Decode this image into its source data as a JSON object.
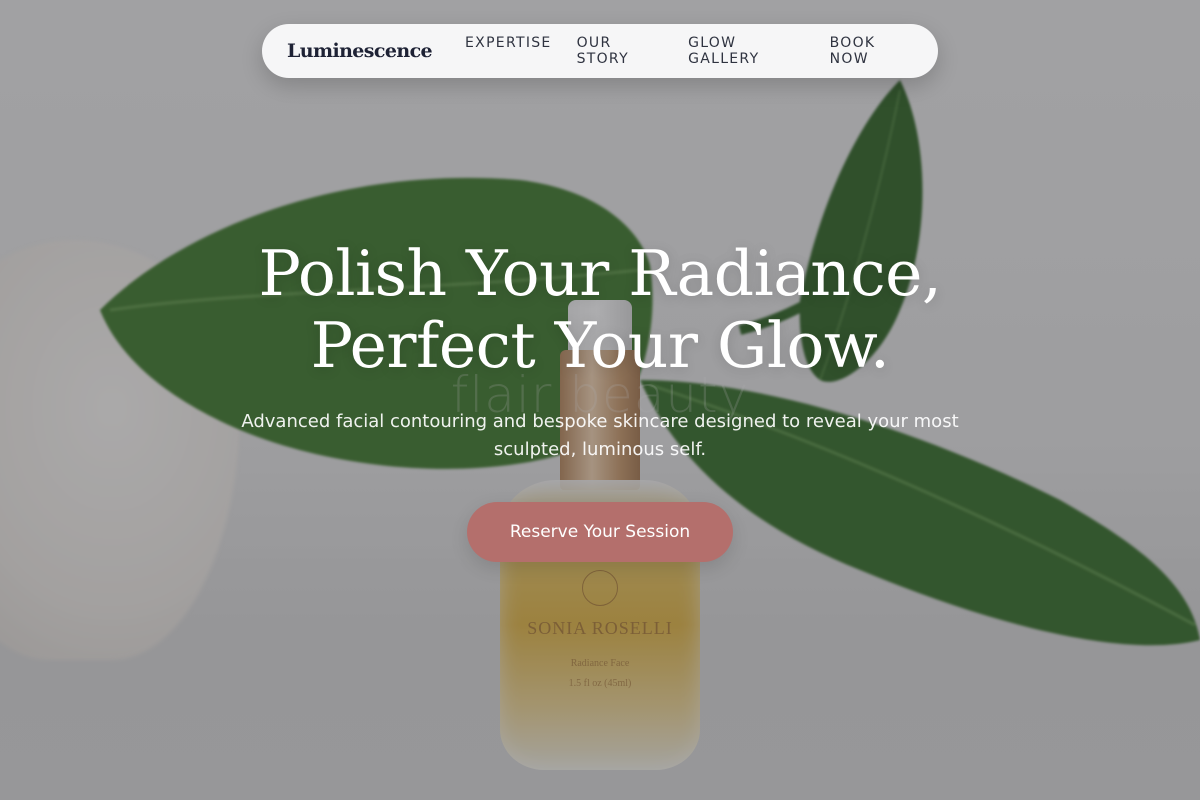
{
  "nav": {
    "logo": "Luminescence",
    "links": [
      "EXPERTISE",
      "OUR STORY",
      "GLOW GALLERY",
      "BOOK NOW"
    ]
  },
  "hero": {
    "headline_line1": "Polish Your Radiance,",
    "headline_line2": "Perfect Your Glow.",
    "subtext": "Advanced facial contouring and bespoke skincare designed to reveal your most sculpted, luminous self.",
    "cta_label": "Reserve Your Session"
  },
  "background": {
    "watermark": "flair beauty",
    "bottle_brand": "SONIA ROSELLI",
    "bottle_line1": "Radiance Face",
    "bottle_line2": "1.5 fl oz (45ml)"
  },
  "colors": {
    "cta": "#b46f6c",
    "nav_bg": "#f6f6f7",
    "logo_text": "#1e2235"
  }
}
